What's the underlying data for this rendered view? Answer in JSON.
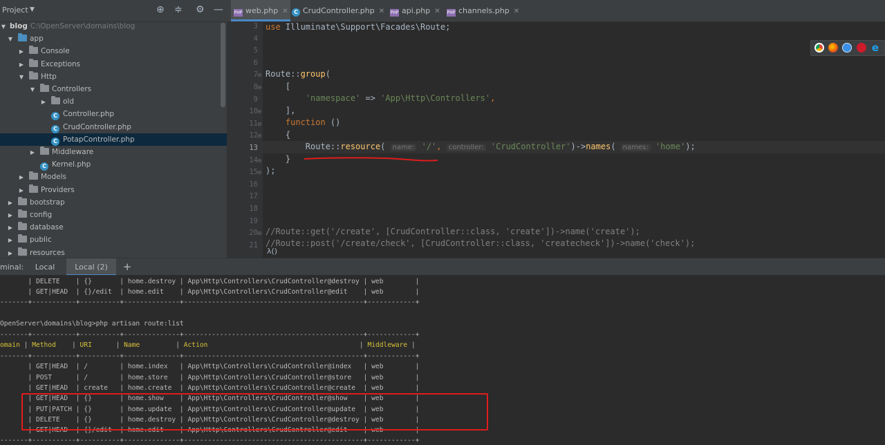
{
  "project_panel": {
    "title": "Project",
    "tree": [
      {
        "label": "blog",
        "path": "C:\\OpenServer\\domains\\blog",
        "indent": 0,
        "type": "root",
        "expanded": true
      },
      {
        "label": "app",
        "indent": 1,
        "type": "folder-blue",
        "expanded": true
      },
      {
        "label": "Console",
        "indent": 2,
        "type": "folder",
        "expanded": false
      },
      {
        "label": "Exceptions",
        "indent": 2,
        "type": "folder",
        "expanded": false
      },
      {
        "label": "Http",
        "indent": 2,
        "type": "folder",
        "expanded": true
      },
      {
        "label": "Controllers",
        "indent": 3,
        "type": "folder",
        "expanded": true
      },
      {
        "label": "old",
        "indent": 4,
        "type": "folder",
        "expanded": false
      },
      {
        "label": "Controller.php",
        "indent": 4,
        "type": "class"
      },
      {
        "label": "CrudController.php",
        "indent": 4,
        "type": "class"
      },
      {
        "label": "PotapController.php",
        "indent": 4,
        "type": "class",
        "selected": true
      },
      {
        "label": "Middleware",
        "indent": 3,
        "type": "folder",
        "expanded": false
      },
      {
        "label": "Kernel.php",
        "indent": 3,
        "type": "class"
      },
      {
        "label": "Models",
        "indent": 2,
        "type": "folder",
        "expanded": false
      },
      {
        "label": "Providers",
        "indent": 2,
        "type": "folder",
        "expanded": false
      },
      {
        "label": "bootstrap",
        "indent": 1,
        "type": "folder",
        "expanded": false
      },
      {
        "label": "config",
        "indent": 1,
        "type": "folder",
        "expanded": false
      },
      {
        "label": "database",
        "indent": 1,
        "type": "folder",
        "expanded": false
      },
      {
        "label": "public",
        "indent": 1,
        "type": "folder",
        "expanded": false
      },
      {
        "label": "resources",
        "indent": 1,
        "type": "folder",
        "expanded": false
      }
    ]
  },
  "editor": {
    "tabs": [
      {
        "label": "web.php",
        "icon": "php",
        "active": true
      },
      {
        "label": "CrudController.php",
        "icon": "class",
        "active": false
      },
      {
        "label": "api.php",
        "icon": "php",
        "active": false
      },
      {
        "label": "channels.php",
        "icon": "php",
        "active": false
      }
    ],
    "line_numbers": [
      "3",
      "4",
      "5",
      "6",
      "7",
      "8",
      "9",
      "10",
      "11",
      "12",
      "13",
      "14",
      "15",
      "16",
      "17",
      "18",
      "19",
      "20",
      "21"
    ],
    "current_line": "13",
    "code": {
      "l3_use": "use",
      "l3_ns": " Illuminate\\Support\\Facades\\Route;",
      "l7_route": "Route::",
      "l7_group": "group",
      "l7_paren": "(",
      "l8": "    [",
      "l9_key": "'namespace'",
      "l9_arrow": " => ",
      "l9_val": "'App\\Http\\Controllers'",
      "l9_comma": ",",
      "l10": "    ],",
      "l11_fn": "function",
      "l11_rest": " ()",
      "l12": "    {",
      "l13_route": "Route::",
      "l13_resource": "resource",
      "l13_open": "(",
      "l13_hint1": "name:",
      "l13_arg1": "'/'",
      "l13_hint2": "controller:",
      "l13_arg2": "'CrudController'",
      "l13_mid": ")->",
      "l13_names": "names",
      "l13_hint3": "names:",
      "l13_arg3": "'home'",
      "l13_close": ");",
      "l14": "    }",
      "l15": ");",
      "l20": "//Route::get('/create', [CrudController::class, 'create'])->name('create');",
      "l21": "//Route::post('/create/check', [CrudController::class, 'createcheck'])->name('check');"
    },
    "breadcrumb": "λ()"
  },
  "browsers": [
    "chrome-icon",
    "firefox-icon",
    "safari-icon",
    "opera-icon",
    "ie-icon"
  ],
  "terminal": {
    "label": "minal:",
    "tabs": [
      {
        "label": "Local",
        "active": false
      },
      {
        "label": "Local (2)",
        "active": true
      }
    ],
    "add_label": "+",
    "lines": [
      {
        "text": "       | DELETE    | {}       | home.destroy | App\\Http\\Controllers\\CrudController@destroy | web        |",
        "style": "normal"
      },
      {
        "text": "       | GET|HEAD  | {}/edit  | home.edit    | App\\Http\\Controllers\\CrudController@edit    | web        |",
        "style": "normal"
      },
      {
        "text": "-------+-----------+----------+--------------+---------------------------------------------+------------+",
        "style": "normal"
      },
      {
        "text": "",
        "style": "normal"
      },
      {
        "text": "OpenServer\\domains\\blog>php artisan route:list",
        "style": "normal"
      },
      {
        "text": "-------+-----------+----------+--------------+---------------------------------------------+------------+",
        "style": "normal"
      },
      {
        "text": "omain | Method    | URI      | Name         | Action                                      | Middleware |",
        "style": "header"
      },
      {
        "text": "-------+-----------+----------+--------------+---------------------------------------------+------------+",
        "style": "normal"
      },
      {
        "text": "       | GET|HEAD  | /        | home.index   | App\\Http\\Controllers\\CrudController@index   | web        |",
        "style": "normal"
      },
      {
        "text": "       | POST      | /        | home.store   | App\\Http\\Controllers\\CrudController@store   | web        |",
        "style": "normal"
      },
      {
        "text": "       | GET|HEAD  | create   | home.create  | App\\Http\\Controllers\\CrudController@create  | web        |",
        "style": "normal"
      },
      {
        "text": "       | GET|HEAD  | {}       | home.show    | App\\Http\\Controllers\\CrudController@show    | web        |",
        "style": "normal"
      },
      {
        "text": "       | PUT|PATCH | {}       | home.update  | App\\Http\\Controllers\\CrudController@update  | web        |",
        "style": "normal"
      },
      {
        "text": "       | DELETE    | {}       | home.destroy | App\\Http\\Controllers\\CrudController@destroy | web        |",
        "style": "normal"
      },
      {
        "text": "       | GET|HEAD  | {}/edit  | home.edit    | App\\Http\\Controllers\\CrudController@edit    | web        |",
        "style": "normal"
      },
      {
        "text": "-------+-----------+----------+--------------+---------------------------------------------+------------+",
        "style": "normal"
      }
    ]
  },
  "colors": {
    "annotation_red": "#e01c1c",
    "accent_blue": "#4a88c7"
  }
}
